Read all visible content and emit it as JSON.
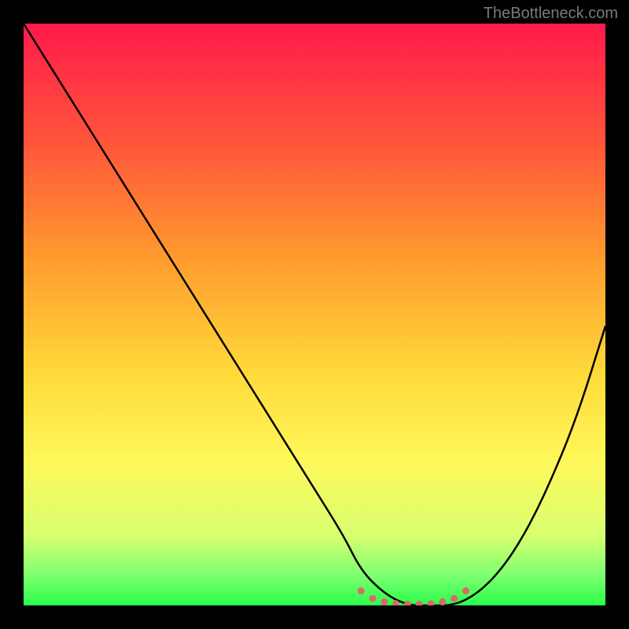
{
  "watermark": "TheBottleneck.com",
  "chart_data": {
    "type": "line",
    "title": "",
    "xlabel": "",
    "ylabel": "",
    "xlim": [
      0,
      100
    ],
    "ylim": [
      0,
      100
    ],
    "gradient_stops": [
      {
        "offset": 0,
        "color": "#ff1a4a"
      },
      {
        "offset": 20,
        "color": "#ff533b"
      },
      {
        "offset": 40,
        "color": "#ff9a2e"
      },
      {
        "offset": 60,
        "color": "#ffd93a"
      },
      {
        "offset": 75,
        "color": "#fff85a"
      },
      {
        "offset": 88,
        "color": "#d8ff70"
      },
      {
        "offset": 95,
        "color": "#7aff70"
      },
      {
        "offset": 100,
        "color": "#2aff4a"
      }
    ],
    "series": [
      {
        "name": "bottleneck-curve",
        "color": "#000000",
        "x": [
          0,
          5,
          10,
          15,
          20,
          25,
          30,
          35,
          40,
          45,
          50,
          55,
          58,
          62,
          66,
          70,
          74,
          78,
          82,
          86,
          90,
          95,
          100
        ],
        "y": [
          100,
          92,
          84,
          76,
          68,
          60,
          52,
          44,
          36,
          28,
          20,
          12,
          6,
          2,
          0,
          0,
          0,
          2,
          6,
          12,
          20,
          32,
          48
        ]
      }
    ],
    "markers": {
      "color": "#d86a6a",
      "points": [
        {
          "x": 58,
          "y": 2.5
        },
        {
          "x": 60,
          "y": 1.2
        },
        {
          "x": 62,
          "y": 0.6
        },
        {
          "x": 64,
          "y": 0.3
        },
        {
          "x": 66,
          "y": 0.2
        },
        {
          "x": 68,
          "y": 0.2
        },
        {
          "x": 70,
          "y": 0.3
        },
        {
          "x": 72,
          "y": 0.6
        },
        {
          "x": 74,
          "y": 1.2
        },
        {
          "x": 76,
          "y": 2.5
        }
      ]
    }
  }
}
